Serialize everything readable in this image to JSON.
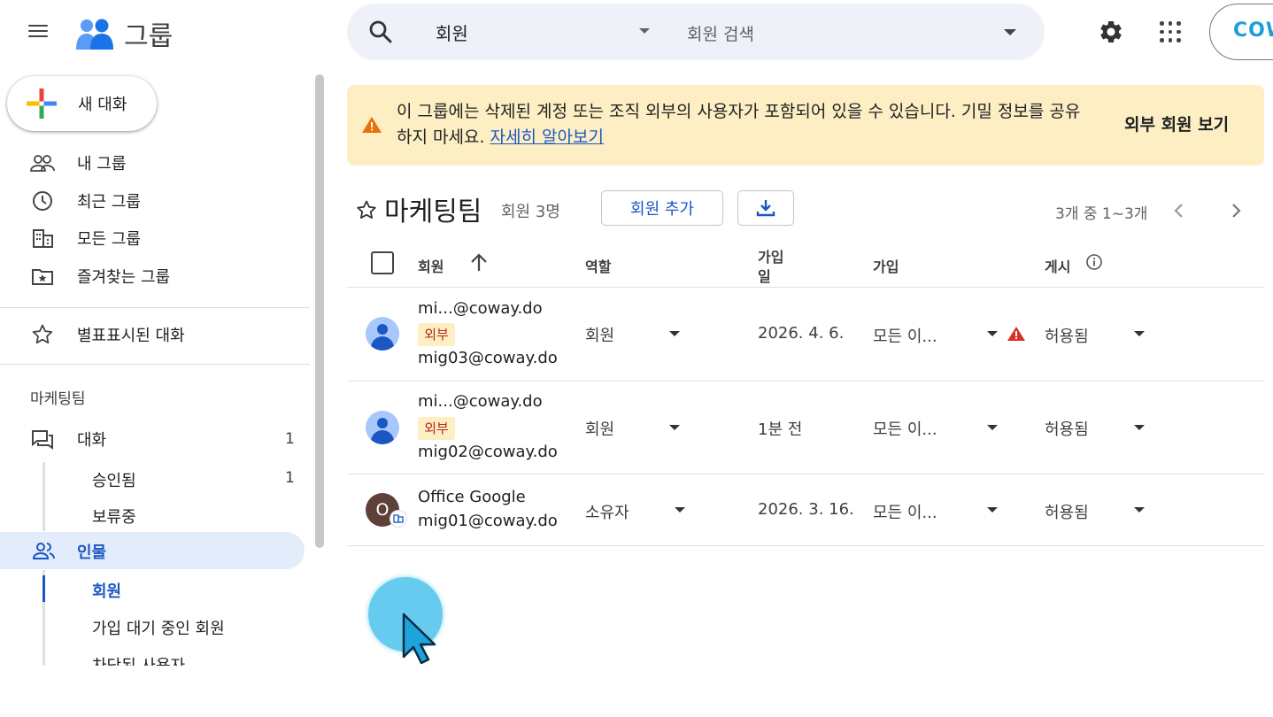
{
  "app": {
    "title": "그룹",
    "brand": "COWAY"
  },
  "search": {
    "scope": "회원",
    "placeholder": "회원 검색"
  },
  "sidebar": {
    "new_chat": "새 대화",
    "items": [
      {
        "label": "내 그룹",
        "icon": "people-icon"
      },
      {
        "label": "최근 그룹",
        "icon": "clock-icon"
      },
      {
        "label": "모든 그룹",
        "icon": "building-icon"
      },
      {
        "label": "즐겨찾는 그룹",
        "icon": "folder-star-icon"
      }
    ],
    "starred": "별표표시된 대화",
    "group_section": "마케팅팀",
    "conversations": {
      "label": "대화",
      "count": "1"
    },
    "approved": {
      "label": "승인됨",
      "count": "1"
    },
    "pending": {
      "label": "보류중"
    },
    "people": {
      "label": "인물"
    },
    "members": {
      "label": "회원"
    },
    "waiting": {
      "label": "가입 대기 중인 회원"
    },
    "blocked": {
      "label": "차단된 사용자"
    }
  },
  "banner": {
    "text": "이 그룹에는 삭제된 계정 또는 조직 외부의 사용자가 포함되어 있을 수 있습니다. 기밀 정보를 공유하지 마세요.",
    "link": "자세히 알아보기",
    "action": "외부 회원 보기"
  },
  "group": {
    "title": "마케팅팀",
    "count": "회원 3명",
    "add_member": "회원 추가",
    "pagination": "3개 중 1~3개"
  },
  "table": {
    "headers": {
      "member": "회원",
      "role": "역할",
      "joined_line1": "가입",
      "joined_line2": "일",
      "join_method": "가입",
      "posting": "게시"
    },
    "rows": [
      {
        "display": "mi...@coway.do",
        "badge": "외부",
        "email": "mig03@coway.do",
        "role": "회원",
        "joined": "2026. 4. 6.",
        "join": "모든 이...",
        "posting": "허용됨",
        "warning": true
      },
      {
        "display": "mi...@coway.do",
        "badge": "외부",
        "email": "mig02@coway.do",
        "role": "회원",
        "joined": "1분 전",
        "join": "모든 이...",
        "posting": "허용됨",
        "warning": false
      },
      {
        "display": "Office Google",
        "badge": "",
        "email": "mig01@coway.do",
        "role": "소유자",
        "joined": "2026. 3. 16.",
        "join": "모든 이...",
        "posting": "허용됨",
        "warning": false,
        "avatar_letter": "O"
      }
    ]
  },
  "colors": {
    "accent": "#1a57c4",
    "banner_bg": "#fdefc3",
    "active_nav": "#e3ecfb",
    "warning": "#e8710a",
    "error": "#d93025"
  }
}
